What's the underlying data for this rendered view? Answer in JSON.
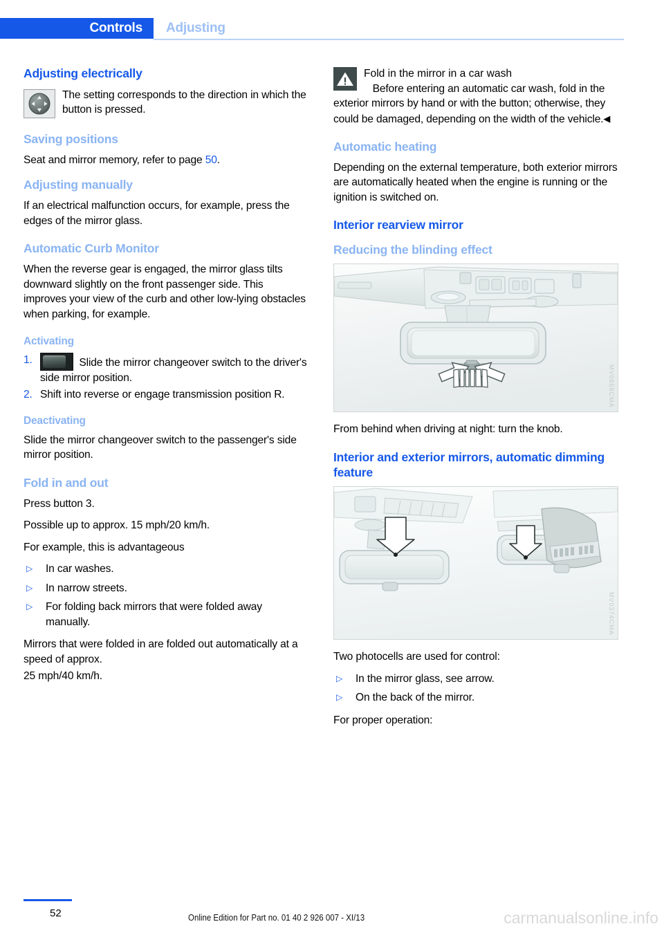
{
  "header": {
    "tab_label": "Controls",
    "section_label": "Adjusting",
    "accent_color": "#1558e8",
    "muted_accent_color": "#8ab4f2"
  },
  "left_column": {
    "heading_adjusting_electrically": "Adjusting electrically",
    "joystick_note": "The setting corresponds to the direction in which the button is pressed.",
    "heading_saving_positions": "Saving positions",
    "saving_positions_text_before": "Seat and mirror memory, refer to page ",
    "saving_positions_page_ref": "50",
    "saving_positions_text_after": ".",
    "heading_adjusting_manually": "Adjusting manually",
    "adjusting_manually_text": "If an electrical malfunction occurs, for example, press the edges of the mirror glass.",
    "heading_curb_monitor": "Automatic Curb Monitor",
    "curb_monitor_text": "When the reverse gear is engaged, the mirror glass tilts downward slightly on the front passenger side. This improves your view of the curb and other low-lying obstacles when parking, for example.",
    "heading_activating": "Activating",
    "step1_num": "1.",
    "step1_text": "Slide the mirror changeover switch to the driver's side mirror position.",
    "step2_num": "2.",
    "step2_text": "Shift into reverse or engage transmission position R.",
    "heading_deactivating": "Deactivating",
    "deactivating_text": "Slide the mirror changeover switch to the passenger's side mirror position.",
    "heading_fold_in_out": "Fold in and out",
    "fold_press_button": "Press button 3.",
    "fold_possible_speed": "Possible up to approx. 15 mph/20 km/h.",
    "fold_example_intro": "For example, this is advantageous",
    "fold_bullets": [
      "In car washes.",
      "In narrow streets.",
      "For folding back mirrors that were folded away manually."
    ],
    "fold_auto_text": "Mirrors that were folded in are folded out automatically at a speed of approx.",
    "fold_auto_speed": "25 mph/40 km/h."
  },
  "right_column": {
    "warning_title": "Fold in the mirror in a car wash",
    "warning_body": "Before entering an automatic car wash, fold in the exterior mirrors by hand or with the button; otherwise, they could be damaged, depending on the width of the vehicle.",
    "warning_end_mark": "◀",
    "heading_automatic_heating": "Automatic heating",
    "automatic_heating_text": "Depending on the external temperature, both exterior mirrors are automatically heated when the engine is running or the ignition is switched on.",
    "heading_interior_rearview_mirror": "Interior rearview mirror",
    "heading_reducing_blinding": "Reducing the blinding effect",
    "figure1_code": "MV0659CMA",
    "figure1_caption": "From behind when driving at night: turn the knob.",
    "heading_interior_exterior_dimming": "Interior and exterior mirrors, automatic dimming feature",
    "figure2_code": "MV0374CMA",
    "photocells_intro": "Two photocells are used for control:",
    "photocell_bullets": [
      "In the mirror glass, see arrow.",
      "On the back of the mirror."
    ],
    "proper_operation_text": "For proper operation:"
  },
  "icons": {
    "joystick": "joystick-button-icon",
    "switch": "rocker-switch-icon",
    "warning": "warning-triangle-icon",
    "bullet": "▷"
  },
  "footer": {
    "page_number": "52",
    "edition_text": "Online Edition for Part no. 01 40 2 926 007 - XI/13",
    "watermark": "carmanualsonline.info"
  }
}
